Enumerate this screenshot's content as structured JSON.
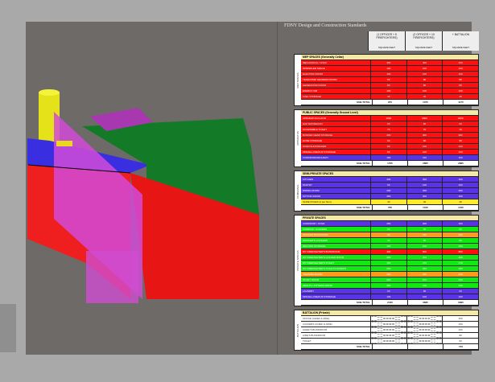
{
  "doc_title": "FDNY Design and Construction Standards",
  "columns": [
    "(1 OFFICER + 5 FIREFIGHTERS)",
    "(2 OFFICER + 10 FIREFIGHTERS)",
    "+ BATTALION"
  ],
  "column_units": [
    "SQUARE FEET",
    "SQUARE FEET",
    "SQUARE FEET"
  ],
  "sections": [
    {
      "side_label": "MEP SPACES",
      "title": "MEP SPACES (Generally Cellar)",
      "rows": [
        {
          "name": "MECHANICAL / HVAC",
          "c": "red",
          "v": [
            "400",
            "400",
            "400"
          ]
        },
        {
          "name": "SPRINKLER SPACE",
          "c": "red",
          "v": [
            "100",
            "100",
            "100"
          ]
        },
        {
          "name": "ELECTRIC ROOM",
          "c": "red",
          "v": [
            "100",
            "100",
            "100"
          ]
        },
        {
          "name": "TELECOMM HEADEND ROOM",
          "c": "red",
          "v": [
            "80",
            "80",
            "80"
          ]
        },
        {
          "name": "GENERATOR ROOM",
          "c": "red",
          "v": [
            "80",
            "80",
            "80"
          ]
        },
        {
          "name": "ENERGY RM",
          "c": "red",
          "v": [
            "100",
            "100",
            "100"
          ]
        },
        {
          "name": "FUEL STORAGE",
          "c": "red",
          "v": [
            "40",
            "40",
            "40"
          ]
        }
      ],
      "total": [
        "975",
        "1075",
        "1175"
      ]
    },
    {
      "side_label": "APPARATUS",
      "title": "PUBLIC SPACES (Generally Ground Level)",
      "rows": [
        {
          "name": "APPARATUS FLOOR",
          "c": "red",
          "v": [
            "1000",
            "2000",
            "2000"
          ]
        },
        {
          "name": "HAZ MAT/DECON",
          "c": "red",
          "v": [
            "60",
            "60",
            "60"
          ]
        },
        {
          "name": "ACCESSIBLE TOILET",
          "c": "red",
          "v": [
            "70",
            "70",
            "70"
          ]
        },
        {
          "name": "BUNKER GEAR STORAGE",
          "c": "red",
          "v": [
            "200",
            "300",
            "300"
          ]
        },
        {
          "name": "HOSE STORAGE",
          "c": "red",
          "v": [
            "60",
            "60",
            "60"
          ]
        },
        {
          "name": "WORKSHOP/MAKER",
          "c": "red",
          "v": [
            "80",
            "100",
            "100"
          ]
        },
        {
          "name": "MISCELLANEOUS STORAGE",
          "c": "red",
          "v": [
            "80",
            "100",
            "100"
          ]
        },
        {
          "name": "CORRIDOR/ARCHWAY",
          "c": "blue",
          "v": [
            "150",
            "150",
            "150"
          ]
        }
      ],
      "total": [
        "1705",
        "2865",
        "2865"
      ]
    },
    {
      "side_label": "COMMUNAL",
      "title": "SEMI-PRIVATE SPACES",
      "rows": [
        {
          "name": "KITCHEN",
          "c": "blue",
          "v": [
            "200",
            "300",
            "300"
          ]
        },
        {
          "name": "PANTRY",
          "c": "blue",
          "v": [
            "50",
            "100",
            "100"
          ]
        },
        {
          "name": "DINING ROOM",
          "c": "blue",
          "v": [
            "200",
            "300",
            "300"
          ]
        },
        {
          "name": "SITTING ROOM",
          "c": "blue",
          "v": [
            "250",
            "300",
            "300"
          ]
        },
        {
          "name": "SLIDE POLES (2 per floor)",
          "c": "yellow",
          "v": [
            "40",
            "40",
            "40"
          ]
        }
      ],
      "total": [
        "765",
        "1015",
        "1015"
      ]
    },
    {
      "side_label": "PRIVATE SPACES",
      "title": "PRIVATE SPACES",
      "rows": [
        {
          "name": "CORRIDOR / STAIR",
          "c": "blue",
          "v": [
            "250",
            "300",
            "300"
          ]
        },
        {
          "name": "COMPANY LOCKERS",
          "c": "green",
          "v": [
            "50",
            "50",
            "50"
          ]
        },
        {
          "name": "OFFICER BUNKROOM",
          "c": "orange",
          "v": [
            "90",
            "180",
            "180"
          ]
        },
        {
          "name": "OFFICER'S LOCKERS",
          "c": "green",
          "v": [
            "40",
            "80",
            "80"
          ]
        },
        {
          "name": "RECORD STORAGE",
          "c": "green",
          "v": [
            "100",
            "100",
            "100"
          ]
        },
        {
          "name": "MY FIREFIGHTER'S BUNKROOM",
          "c": "red",
          "v": [
            "400",
            "800",
            "800"
          ]
        },
        {
          "name": "MY FIREFIGHTER'S LOCKER ROOM",
          "c": "green",
          "v": [
            "200",
            "400",
            "400"
          ]
        },
        {
          "name": "MY FIREFIGHTER'S TOILET",
          "c": "green",
          "v": [
            "150",
            "270",
            "270"
          ]
        },
        {
          "name": "MY FIREFIGHTER'S TOILET/LOCKERS",
          "c": "green",
          "v": [
            "200",
            "350",
            "350"
          ]
        },
        {
          "name": "TRAINING ROOM",
          "c": "orange",
          "v": [
            "400",
            "400",
            "400"
          ]
        },
        {
          "name": "STUDY ROOM",
          "c": "green",
          "v": [
            "200",
            "200",
            "200"
          ]
        },
        {
          "name": "HEALTH / FITNESS ROOM",
          "c": "green",
          "v": [
            "400",
            "700",
            "700"
          ]
        },
        {
          "name": "LAUNDRY",
          "c": "blue",
          "v": [
            "60",
            "60",
            "60"
          ]
        },
        {
          "name": "MISCELLANEOUS STORAGE",
          "c": "blue",
          "v": [
            "100",
            "100",
            "100"
          ]
        }
      ],
      "total": [
        "2440",
        "3835",
        "3995"
      ]
    },
    {
      "side_label": "BATTALION",
      "title": "BATTALION (Private)",
      "rows": [
        {
          "name": "OFFICE (CHIEF & AIDE)",
          "c": "white",
          "v": [
            "",
            "",
            "400"
          ]
        },
        {
          "name": "LOCKERS (CHIEF & AIDE)",
          "c": "white",
          "v": [
            "",
            "",
            "100"
          ]
        },
        {
          "name": "CHIEF'S BUNKROOM",
          "c": "white",
          "v": [
            "",
            "",
            "100"
          ]
        },
        {
          "name": "AIDE'S BUNKROOM",
          "c": "white",
          "v": [
            "",
            "",
            "80"
          ]
        },
        {
          "name": "TOILET",
          "c": "white",
          "v": [
            "",
            "",
            "60"
          ]
        }
      ],
      "total": [
        "",
        "",
        "740"
      ]
    }
  ],
  "subtotal_label": "SUB-TOTAL",
  "colors": {
    "red": "#ff1010",
    "blue": "#5a32e8",
    "green": "#12e812",
    "yellow": "#ffeb2a",
    "magenta": "#c040c8",
    "background": "#6d6a68"
  }
}
